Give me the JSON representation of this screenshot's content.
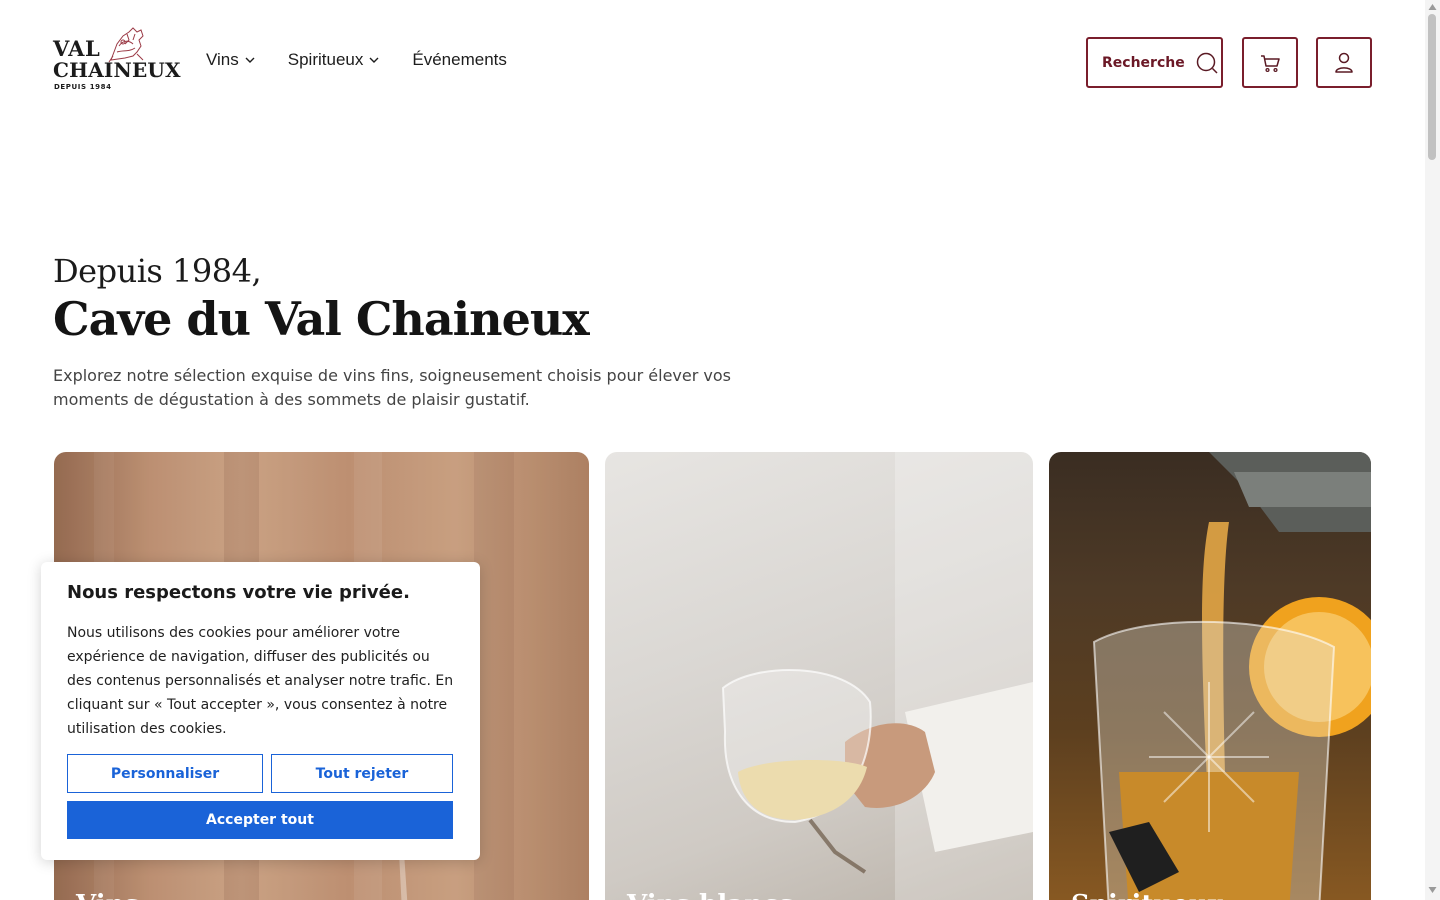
{
  "brand": {
    "line1": "VAL",
    "line2": "CHAINEUX",
    "line3": "DEPUIS 1984"
  },
  "nav": {
    "items": [
      {
        "label": "Vins",
        "has_dropdown": true
      },
      {
        "label": "Spiritueux",
        "has_dropdown": true
      },
      {
        "label": "Événements",
        "has_dropdown": false
      }
    ]
  },
  "header_actions": {
    "search_label": "Recherche",
    "search_icon": "search-icon",
    "cart_icon": "cart-icon",
    "account_icon": "user-icon"
  },
  "hero": {
    "subtitle": "Depuis 1984,",
    "title": "Cave du Val Chaineux",
    "description": "Explorez notre sélection exquise de vins fins, soigneusement choisis pour élever vos moments de dégustation à des sommets de plaisir gustatif."
  },
  "cards": [
    {
      "label": "Vins"
    },
    {
      "label": "Vins blancs"
    },
    {
      "label": "Spiritueux"
    }
  ],
  "cookie_banner": {
    "title": "Nous respectons votre vie privée.",
    "text": "Nous utilisons des cookies pour améliorer votre expérience de navigation, diffuser des publicités ou des contenus personnalisés et analyser notre trafic. En cliquant sur « Tout accepter », vous consentez à notre utilisation des cookies.",
    "customize_label": "Personnaliser",
    "reject_label": "Tout rejeter",
    "accept_label": "Accepter tout"
  },
  "colors": {
    "brand_burgundy": "#7a1e2c",
    "cookie_blue": "#1a63d8"
  }
}
